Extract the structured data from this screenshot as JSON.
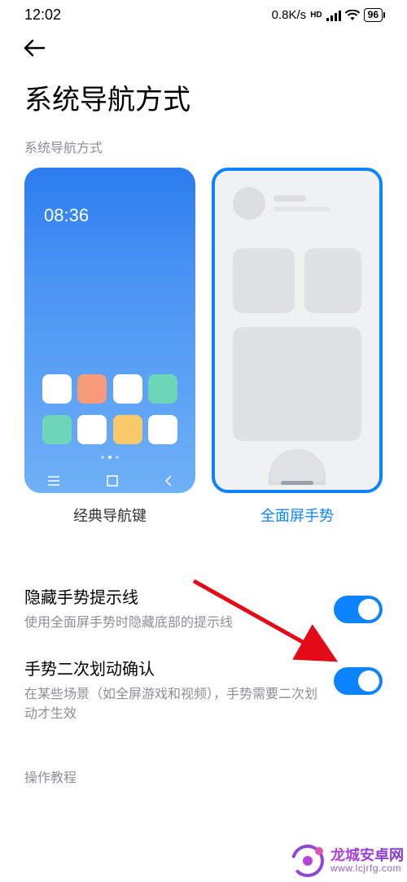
{
  "status": {
    "time": "12:02",
    "net_speed": "0.8K/s",
    "hd_label": "HD",
    "battery": "96"
  },
  "page": {
    "title": "系统导航方式"
  },
  "section_label": "系统导航方式",
  "options": {
    "classic": {
      "label": "经典导航键",
      "preview_time": "08:36"
    },
    "gesture": {
      "label": "全面屏手势"
    },
    "selected": "gesture"
  },
  "settings": {
    "hide_hint": {
      "title": "隐藏手势提示线",
      "desc": "使用全面屏手势时隐藏底部的提示线",
      "on": true
    },
    "double_swipe": {
      "title": "手势二次划动确认",
      "desc": "在某些场景（如全屏游戏和视频），手势需要二次划动才生效",
      "on": true
    }
  },
  "tutorial_label": "操作教程",
  "watermark": {
    "name": "龙城安卓网",
    "url": "www.lcjrfg.com"
  }
}
